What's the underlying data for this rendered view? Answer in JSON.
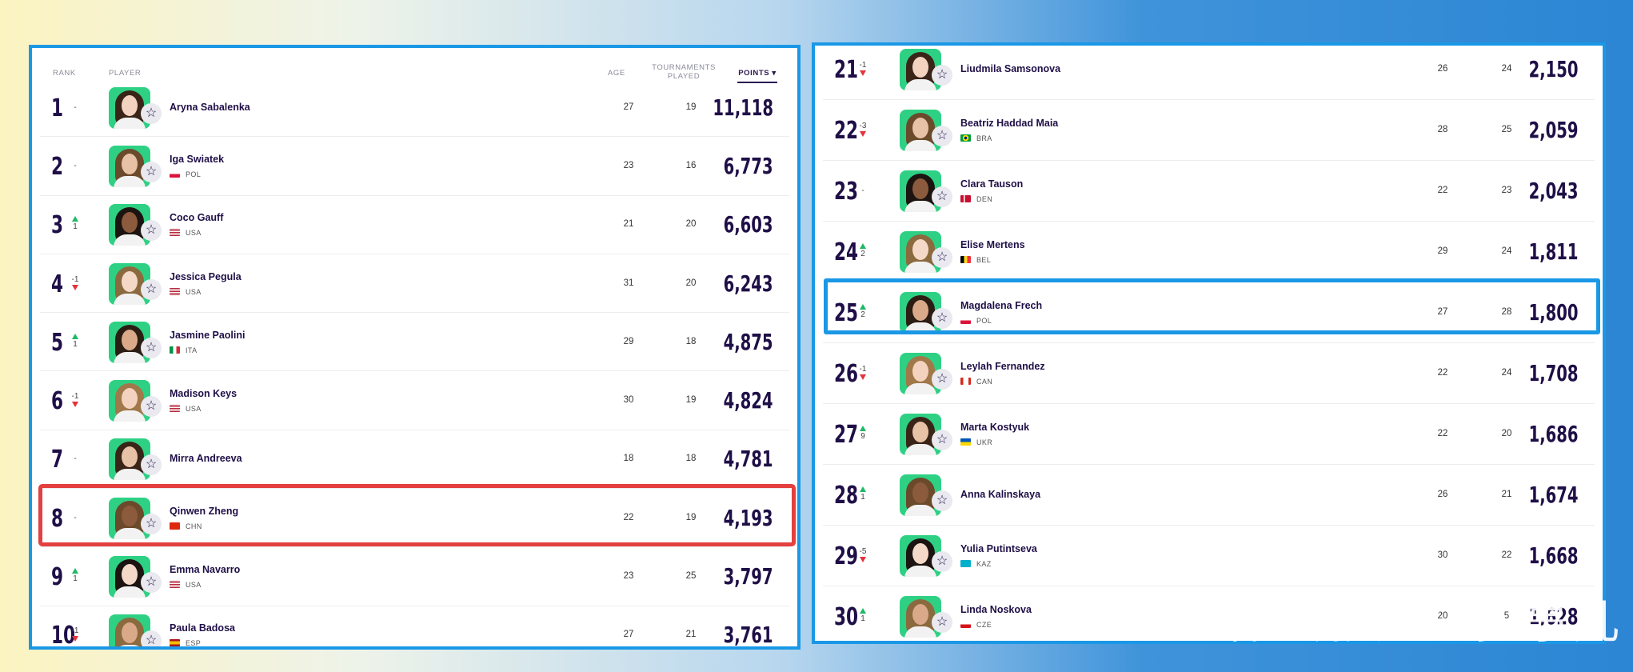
{
  "headers": {
    "rank": "RANK",
    "player": "PLAYER",
    "age": "AGE",
    "tournaments_1": "TOURNAMENTS",
    "tournaments_2": "PLAYED",
    "points": "POINTS ▾"
  },
  "left_players": [
    {
      "rank": "1",
      "move": "-",
      "dir": "none",
      "name": "Aryna Sabalenka",
      "country": "",
      "flag": "none",
      "age": "27",
      "tournaments": "19",
      "points": "11,118"
    },
    {
      "rank": "2",
      "move": "-",
      "dir": "none",
      "name": "Iga Swiatek",
      "country": "POL",
      "flag": "pol",
      "age": "23",
      "tournaments": "16",
      "points": "6,773"
    },
    {
      "rank": "3",
      "move": "1",
      "dir": "up",
      "name": "Coco Gauff",
      "country": "USA",
      "flag": "usa",
      "age": "21",
      "tournaments": "20",
      "points": "6,603"
    },
    {
      "rank": "4",
      "move": "-1",
      "dir": "down",
      "name": "Jessica Pegula",
      "country": "USA",
      "flag": "usa",
      "age": "31",
      "tournaments": "20",
      "points": "6,243"
    },
    {
      "rank": "5",
      "move": "1",
      "dir": "up",
      "name": "Jasmine Paolini",
      "country": "ITA",
      "flag": "ita",
      "age": "29",
      "tournaments": "18",
      "points": "4,875"
    },
    {
      "rank": "6",
      "move": "-1",
      "dir": "down",
      "name": "Madison Keys",
      "country": "USA",
      "flag": "usa",
      "age": "30",
      "tournaments": "19",
      "points": "4,824"
    },
    {
      "rank": "7",
      "move": "-",
      "dir": "none",
      "name": "Mirra Andreeva",
      "country": "",
      "flag": "none",
      "age": "18",
      "tournaments": "18",
      "points": "4,781"
    },
    {
      "rank": "8",
      "move": "-",
      "dir": "none",
      "name": "Qinwen Zheng",
      "country": "CHN",
      "flag": "chn",
      "age": "22",
      "tournaments": "19",
      "points": "4,193"
    },
    {
      "rank": "9",
      "move": "1",
      "dir": "up",
      "name": "Emma Navarro",
      "country": "USA",
      "flag": "usa",
      "age": "23",
      "tournaments": "25",
      "points": "3,797"
    },
    {
      "rank": "10",
      "move": "-1",
      "dir": "down",
      "name": "Paula Badosa",
      "country": "ESP",
      "flag": "esp",
      "age": "27",
      "tournaments": "21",
      "points": "3,761"
    }
  ],
  "right_players": [
    {
      "rank": "21",
      "move": "-1",
      "dir": "down",
      "name": "Liudmila Samsonova",
      "country": "",
      "flag": "none",
      "age": "26",
      "tournaments": "24",
      "points": "2,150"
    },
    {
      "rank": "22",
      "move": "-3",
      "dir": "down",
      "name": "Beatriz Haddad Maia",
      "country": "BRA",
      "flag": "bra",
      "age": "28",
      "tournaments": "25",
      "points": "2,059"
    },
    {
      "rank": "23",
      "move": "-",
      "dir": "none",
      "name": "Clara Tauson",
      "country": "DEN",
      "flag": "den",
      "age": "22",
      "tournaments": "23",
      "points": "2,043"
    },
    {
      "rank": "24",
      "move": "2",
      "dir": "up",
      "name": "Elise Mertens",
      "country": "BEL",
      "flag": "bel",
      "age": "29",
      "tournaments": "24",
      "points": "1,811"
    },
    {
      "rank": "25",
      "move": "2",
      "dir": "up",
      "name": "Magdalena Frech",
      "country": "POL",
      "flag": "pol",
      "age": "27",
      "tournaments": "28",
      "points": "1,800"
    },
    {
      "rank": "26",
      "move": "-1",
      "dir": "down",
      "name": "Leylah Fernandez",
      "country": "CAN",
      "flag": "can",
      "age": "22",
      "tournaments": "24",
      "points": "1,708"
    },
    {
      "rank": "27",
      "move": "9",
      "dir": "up",
      "name": "Marta Kostyuk",
      "country": "UKR",
      "flag": "ukr",
      "age": "22",
      "tournaments": "20",
      "points": "1,686"
    },
    {
      "rank": "28",
      "move": "1",
      "dir": "up",
      "name": "Anna Kalinskaya",
      "country": "",
      "flag": "none",
      "age": "26",
      "tournaments": "21",
      "points": "1,674"
    },
    {
      "rank": "29",
      "move": "-5",
      "dir": "down",
      "name": "Yulia Putintseva",
      "country": "KAZ",
      "flag": "kaz",
      "age": "30",
      "tournaments": "22",
      "points": "1,668"
    },
    {
      "rank": "30",
      "move": "1",
      "dir": "up",
      "name": "Linda Noskova",
      "country": "CZE",
      "flag": "cze",
      "age": "20",
      "tournaments": "5",
      "points": "1,628"
    }
  ],
  "highlights": {
    "left_rank": "8",
    "right_rank": "25"
  },
  "watermark": "体坛就这么多事儿",
  "colors": {
    "highlight_red": "#e3403f",
    "highlight_blue": "#1a98e6",
    "rank_text": "#1f0f47",
    "avatar_bg": "#2ed184",
    "up": "#1fb864",
    "down": "#e5323a"
  }
}
